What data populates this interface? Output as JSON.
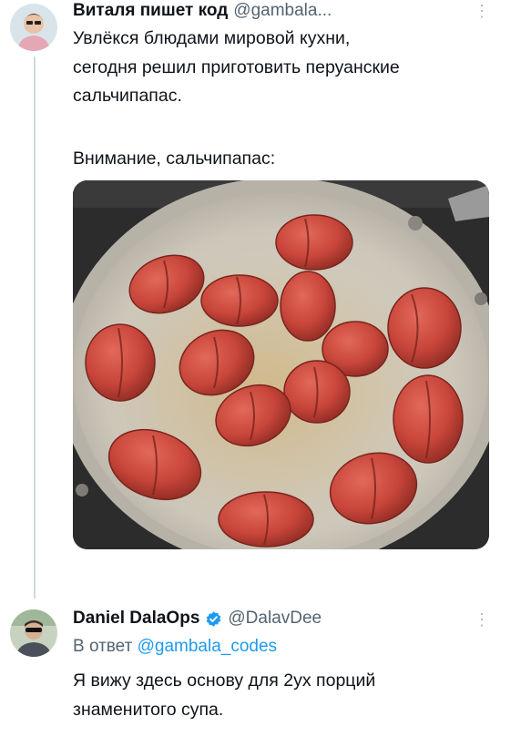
{
  "tweet": {
    "author_name": "Виталя пишет код",
    "author_handle": "@gambala...",
    "avatar_icon": "avatar-photo-icon",
    "lines": [
      "Увлёкся блюдами мировой кухни,",
      "сегодня решил приготовить перуанские",
      "сальчипапас."
    ],
    "second_paragraph": "Внимание, сальчипапас:",
    "media_description_icon": "sausages-in-pan-photo"
  },
  "reply": {
    "author_name": "Daniel DalaOps",
    "author_handle": "@DalavDee",
    "reply_prefix": "В ответ",
    "reply_mention": "@gambala_codes",
    "lines": [
      "Я вижу здесь основу для 2ух порций",
      "знаменитого супа."
    ],
    "verified_color": "#1d9bf0"
  },
  "colors": {
    "text": "#0f1419",
    "secondary": "#536471",
    "link": "#1d9bf0",
    "thread_line": "#cfd9de"
  },
  "icons": {
    "more": "more-icon",
    "verified": "verified-badge-icon"
  }
}
